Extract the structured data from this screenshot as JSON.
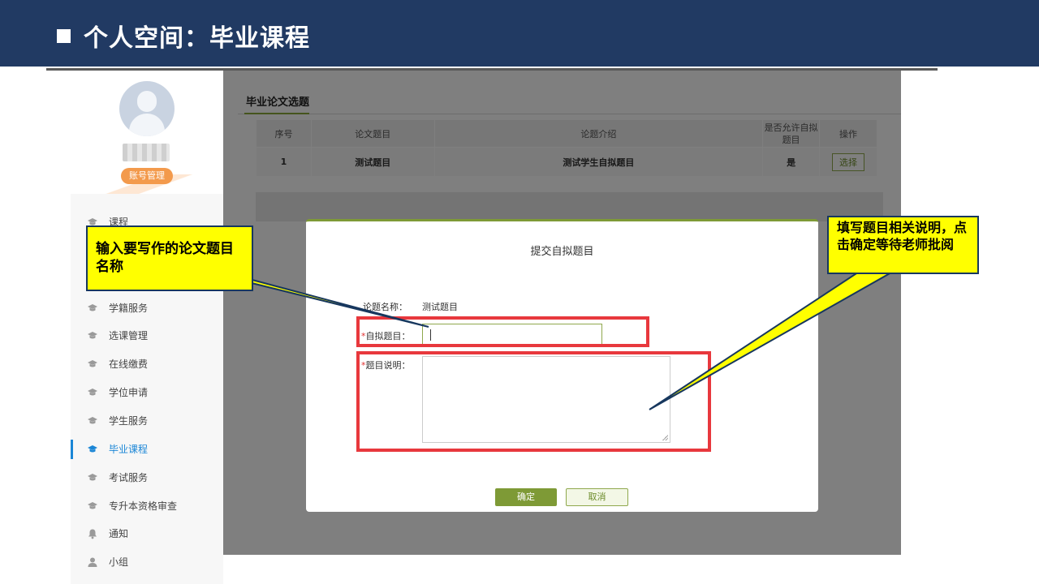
{
  "slide": {
    "title": "个人空间：毕业课程"
  },
  "sidebar": {
    "account_button": "账号管理",
    "items": [
      {
        "label": "课程",
        "icon": "graduation-cap-icon"
      },
      {
        "label": "学籍服务",
        "icon": "graduation-cap-icon"
      },
      {
        "label": "选课管理",
        "icon": "graduation-cap-icon"
      },
      {
        "label": "在线缴费",
        "icon": "graduation-cap-icon"
      },
      {
        "label": "学位申请",
        "icon": "graduation-cap-icon"
      },
      {
        "label": "学生服务",
        "icon": "graduation-cap-icon"
      },
      {
        "label": "毕业课程",
        "icon": "graduation-cap-icon",
        "active": true
      },
      {
        "label": "考试服务",
        "icon": "graduation-cap-icon"
      },
      {
        "label": "专升本资格审查",
        "icon": "graduation-cap-icon"
      },
      {
        "label": "通知",
        "icon": "bell-icon"
      },
      {
        "label": "小组",
        "icon": "user-icon"
      }
    ]
  },
  "main": {
    "tab_label": "毕业论文选题",
    "table": {
      "headers": [
        "序号",
        "论文题目",
        "论题介绍",
        "是否允许自拟题目",
        "操作"
      ],
      "rows": [
        {
          "index": "1",
          "title": "测试题目",
          "intro": "测试学生自拟题目",
          "allow_custom": "是",
          "action": "选择"
        }
      ]
    }
  },
  "modal": {
    "title": "提交自拟题目",
    "topic_name_label": "论题名称：",
    "topic_name_value": "测试题目",
    "required_mark": "*",
    "custom_title_label": "自拟题目：",
    "custom_title_value": "",
    "description_label": "题目说明：",
    "description_value": "",
    "confirm_button": "确定",
    "cancel_button": "取消"
  },
  "callouts": {
    "left": "输入要写作的论文题目名称",
    "right": "填写题目相关说明，点击确定等待老师批阅"
  },
  "colors": {
    "header_bg": "#213a63",
    "accent_green": "#7e9a36",
    "highlight_red": "#e8383d",
    "callout_yellow": "#ffff00",
    "active_blue": "#1b86d6",
    "account_orange": "#f39a4c"
  }
}
